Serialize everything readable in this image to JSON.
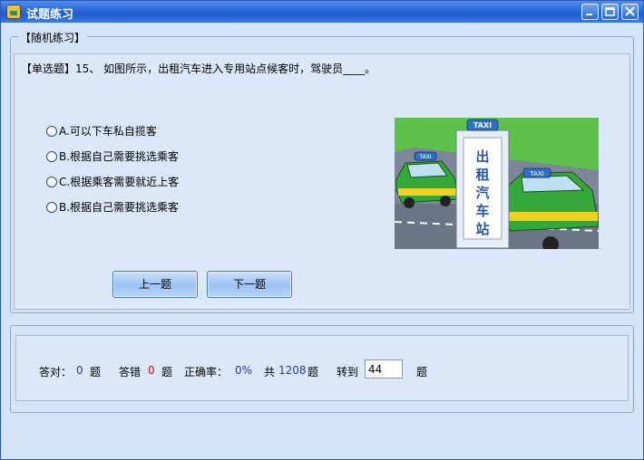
{
  "window": {
    "title": "试题练习"
  },
  "group": {
    "legend": "【随机练习】"
  },
  "question": {
    "text": "【单选题】15、 如图所示，出租汽车进入专用站点候客时，驾驶员____。",
    "options": [
      "A.可以下车私自揽客",
      "B.根据自己需要挑选乘客",
      "C.根据乘客需要就近上客",
      "B.根据自己需要挑选乘客"
    ]
  },
  "figure": {
    "sign_text": [
      "出",
      "租",
      "汽",
      "车",
      "站"
    ],
    "roof_sign": "TAXI",
    "car_sign": "TAXI"
  },
  "nav": {
    "prev": "上一题",
    "next": "下一题"
  },
  "stats": {
    "correct_label": "答对：",
    "correct_value": "0",
    "unit": "题",
    "wrong_label": "答错",
    "wrong_value": "0",
    "rate_label": "正确率：",
    "rate_value": "0%",
    "total_label": "共",
    "total_value": "1208",
    "jump_label": "转到",
    "jump_value": "44"
  }
}
